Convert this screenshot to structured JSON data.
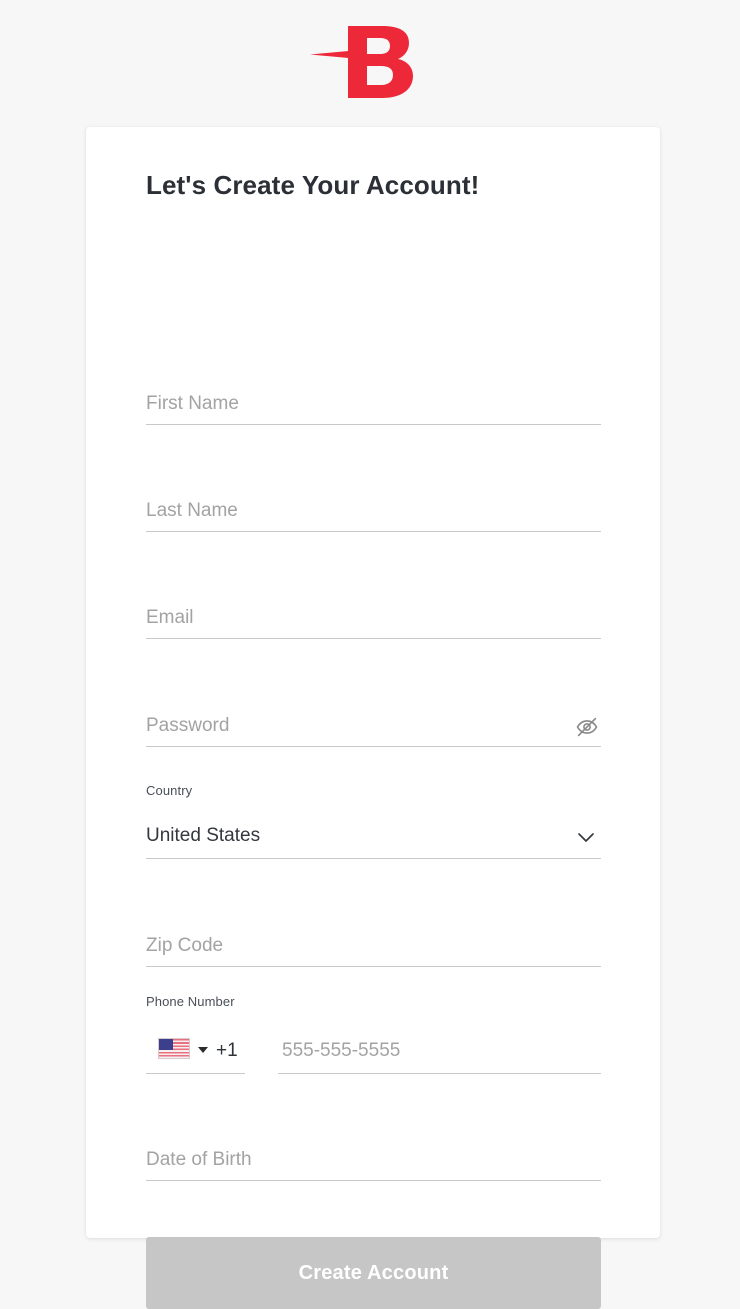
{
  "brand": {
    "logo_icon": "letter-b-logo",
    "logo_letter": "B",
    "logo_color": "#ed2939"
  },
  "card": {
    "heading": "Let's Create Your Account!"
  },
  "form": {
    "first_name": {
      "label": "First Name",
      "placeholder": "First Name",
      "value": ""
    },
    "last_name": {
      "label": "Last Name",
      "placeholder": "Last Name",
      "value": ""
    },
    "email": {
      "label": "Email",
      "placeholder": "Email",
      "value": ""
    },
    "password": {
      "label": "Password",
      "placeholder": "Password",
      "value": "",
      "toggle_icon": "eye-off-icon"
    },
    "country": {
      "label": "Country",
      "value": "United States",
      "chevron_icon": "chevron-down-icon"
    },
    "zip_code": {
      "label": "Zip Code",
      "placeholder": "Zip Code",
      "value": ""
    },
    "phone": {
      "label": "Phone Number",
      "country_flag_icon": "us-flag-icon",
      "country_caret_icon": "caret-down-icon",
      "dial_code": "+1",
      "placeholder": "555-555-5555",
      "value": ""
    },
    "date_of_birth": {
      "label": "Date of Birth",
      "placeholder": "Date of Birth",
      "value": ""
    }
  },
  "actions": {
    "submit_label": "Create Account",
    "submit_disabled_color": "#c6c6c6"
  },
  "theme": {
    "page_background": "#f7f7f7",
    "card_background": "#ffffff",
    "accent": "#ed2939",
    "placeholder_color": "#a3a3a3",
    "underline_color": "#c9c9c9",
    "heading_color": "#2b2f36"
  }
}
